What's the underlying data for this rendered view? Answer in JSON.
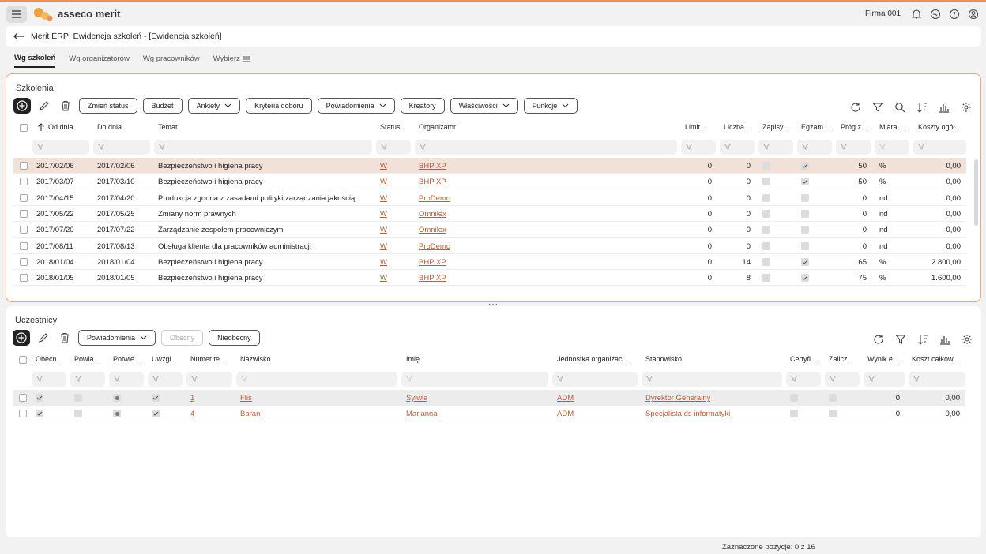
{
  "app": {
    "brand": "asseco merit",
    "company": "Firma 001",
    "window_title": "Merit ERP: Ewidencja szkoleń - [Ewidencja szkoleń]",
    "accent": "#e8935a",
    "link_color": "#b4603b"
  },
  "tabs": [
    {
      "label": "Wg szkoleń",
      "active": true
    },
    {
      "label": "Wg organizatorów"
    },
    {
      "label": "Wg pracowników"
    },
    {
      "label": "Wybierz"
    }
  ],
  "szkolenia": {
    "title": "Szkolenia",
    "buttons": [
      "Zmień status",
      "Budżet",
      "Ankiety",
      "Kryteria doboru",
      "Powiadomienia",
      "Kreatory",
      "Właściwości",
      "Funkcje"
    ],
    "columns": [
      "Od dnia",
      "Do dnia",
      "Temat",
      "Status",
      "Organizator",
      "Limit ...",
      "Liczba...",
      "Zapisy...",
      "Egzam...",
      "Próg z...",
      "Miara ...",
      "Koszty ogół..."
    ],
    "rows": [
      {
        "od": "2017/02/06",
        "do": "2017/02/06",
        "temat": "Bezpieczeństwo i higiena pracy",
        "status": "W",
        "org": "BHP XP",
        "limit": "0",
        "liczba": "0",
        "zapisy": false,
        "egzam": true,
        "prog": "50",
        "miara": "%",
        "koszty": "0,00"
      },
      {
        "od": "2017/03/07",
        "do": "2017/03/10",
        "temat": "Bezpieczeństwo i higiena pracy",
        "status": "W",
        "org": "BHP XP",
        "limit": "0",
        "liczba": "0",
        "zapisy": false,
        "egzam": true,
        "prog": "50",
        "miara": "%",
        "koszty": "0,00"
      },
      {
        "od": "2017/04/15",
        "do": "2017/04/20",
        "temat": "Produkcja zgodna z zasadami polityki zarządzania jakością",
        "status": "W",
        "org": "ProDemo",
        "limit": "0",
        "liczba": "0",
        "zapisy": false,
        "egzam": false,
        "prog": "0",
        "miara": "nd",
        "koszty": "0,00"
      },
      {
        "od": "2017/05/22",
        "do": "2017/05/25",
        "temat": "Zmiany norm prawnych",
        "status": "W",
        "org": "Omnilex",
        "limit": "0",
        "liczba": "0",
        "zapisy": false,
        "egzam": false,
        "prog": "0",
        "miara": "nd",
        "koszty": "0,00"
      },
      {
        "od": "2017/07/20",
        "do": "2017/07/22",
        "temat": "Zarządzanie zespołem pracowniczym",
        "status": "W",
        "org": "Omnilex",
        "limit": "0",
        "liczba": "0",
        "zapisy": false,
        "egzam": false,
        "prog": "0",
        "miara": "nd",
        "koszty": "0,00"
      },
      {
        "od": "2017/08/11",
        "do": "2017/08/13",
        "temat": "Obsługa klienta dla pracowników administracji",
        "status": "W",
        "org": "ProDemo",
        "limit": "0",
        "liczba": "0",
        "zapisy": false,
        "egzam": false,
        "prog": "0",
        "miara": "nd",
        "koszty": "0,00"
      },
      {
        "od": "2018/01/04",
        "do": "2018/01/04",
        "temat": "Bezpieczeństwo i higiena pracy",
        "status": "W",
        "org": "BHP XP",
        "limit": "0",
        "liczba": "14",
        "zapisy": false,
        "egzam": true,
        "prog": "65",
        "miara": "%",
        "koszty": "2.800,00"
      },
      {
        "od": "2018/01/05",
        "do": "2018/01/05",
        "temat": "Bezpieczeństwo i higiena pracy",
        "status": "W",
        "org": "BHP XP",
        "limit": "0",
        "liczba": "8",
        "zapisy": false,
        "egzam": true,
        "prog": "75",
        "miara": "%",
        "koszty": "1.600,00"
      }
    ]
  },
  "uczestnicy": {
    "title": "Uczestnicy",
    "buttons": [
      "Powiadomienia",
      "Obecny",
      "Nieobecny"
    ],
    "columns": [
      "Obecn...",
      "Powia...",
      "Potwie...",
      "Uwzgl...",
      "Numer te...",
      "Nazwisko",
      "Imię",
      "Jednostka organizac...",
      "Stanowisko",
      "Certyfi...",
      "Zalicz...",
      "Wynik e...",
      "Koszt całkow..."
    ],
    "rows": [
      {
        "nr": "1",
        "nazwisko": "Flis",
        "imie": "Sylwia",
        "jednostka": "ADM",
        "stanowisko": "Dyrektor Generalny",
        "wynik": "0",
        "koszt": "0,00"
      },
      {
        "nr": "4",
        "nazwisko": "Baran",
        "imie": "Marianna",
        "jednostka": "ADM",
        "stanowisko": "Specjalista ds informatyki",
        "wynik": "0",
        "koszt": "0,00"
      }
    ]
  },
  "status_bar": "Zaznaczone pozycje: 0 z 16"
}
